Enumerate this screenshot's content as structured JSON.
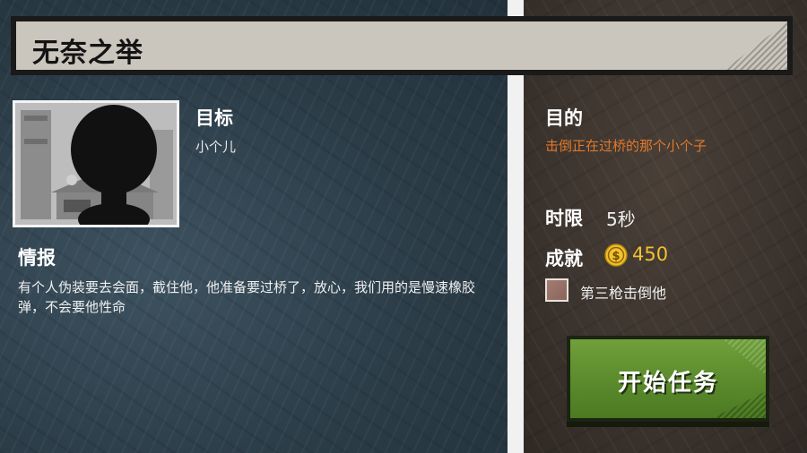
{
  "mission": {
    "title": "无奈之举"
  },
  "target": {
    "heading": "目标",
    "name": "小个儿"
  },
  "intel": {
    "heading": "情报",
    "body": "有个人伪装要去会面，截住他，他准备要过桥了，放心，我们用的是慢速橡胶弹，不会要他性命"
  },
  "objective": {
    "heading": "目的",
    "text": "击倒正在过桥的那个小个子",
    "color": "#e0792b"
  },
  "time_limit": {
    "heading": "时限",
    "value": "5秒"
  },
  "achievement": {
    "heading": "成就",
    "coin_icon": "dollar-coin-icon",
    "reward": "450",
    "reward_color": "#f2c12e",
    "bonus_text": "第三枪击倒他"
  },
  "start_button": {
    "label": "开始任务",
    "color": "#5a8a2c"
  }
}
